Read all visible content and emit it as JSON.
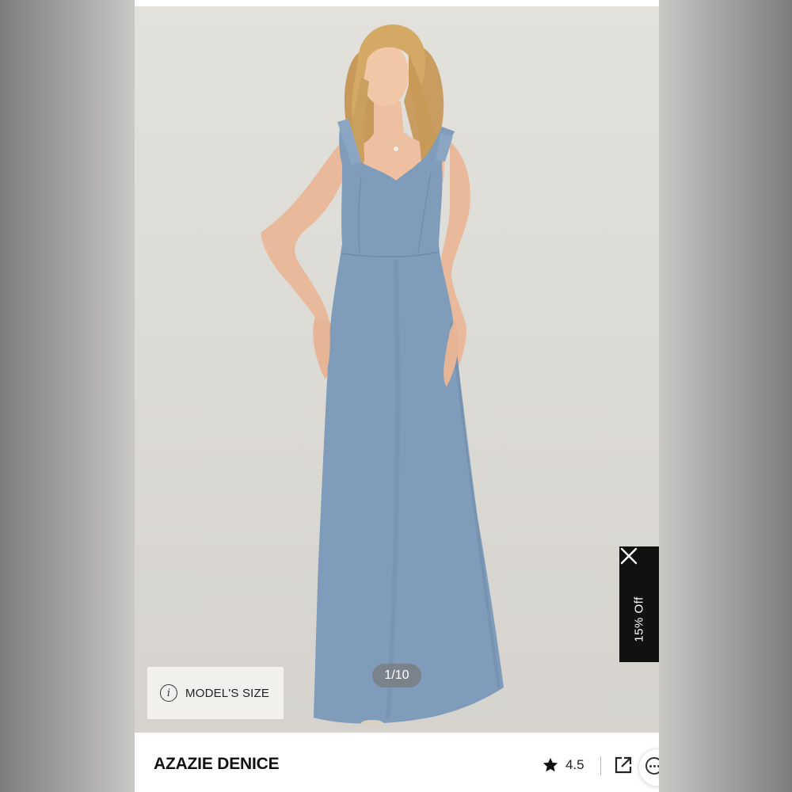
{
  "gallery": {
    "counter": "1/10",
    "model_size_label": "MODEL'S SIZE"
  },
  "promo": {
    "text": "15% Off"
  },
  "product": {
    "name": "AZAZIE DENICE",
    "rating": "4.5"
  },
  "icons": {
    "info": "info-icon",
    "close": "close-icon",
    "star": "star-icon",
    "share": "share-external-icon",
    "more": "more-options-icon"
  },
  "colors": {
    "dress": "#7f9cbb",
    "promo_bg": "#111111",
    "background": "#e0ded9"
  }
}
